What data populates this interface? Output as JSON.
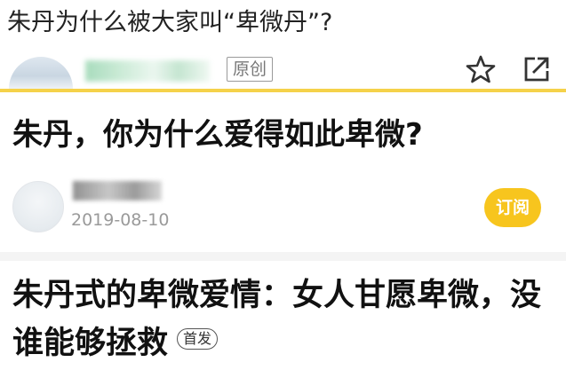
{
  "header": {
    "title": "朱丹为什么被大家叫“卑微丹”?",
    "original_tag": "原创",
    "icons": {
      "favorite": "star-icon",
      "share": "share-arrow-icon"
    }
  },
  "article": {
    "title": "朱丹，你为什么爱得如此卑微?",
    "date": "2019-08-10",
    "subscribe_label": "订阅"
  },
  "next_article": {
    "headline": "朱丹式的卑微爱情：女人甘愿卑微，没谁能够拯救",
    "badge": "首发"
  },
  "colors": {
    "accent_yellow": "#f7c51e",
    "divider_yellow": "#f5d24a",
    "date_gray": "#9a9a9a"
  }
}
